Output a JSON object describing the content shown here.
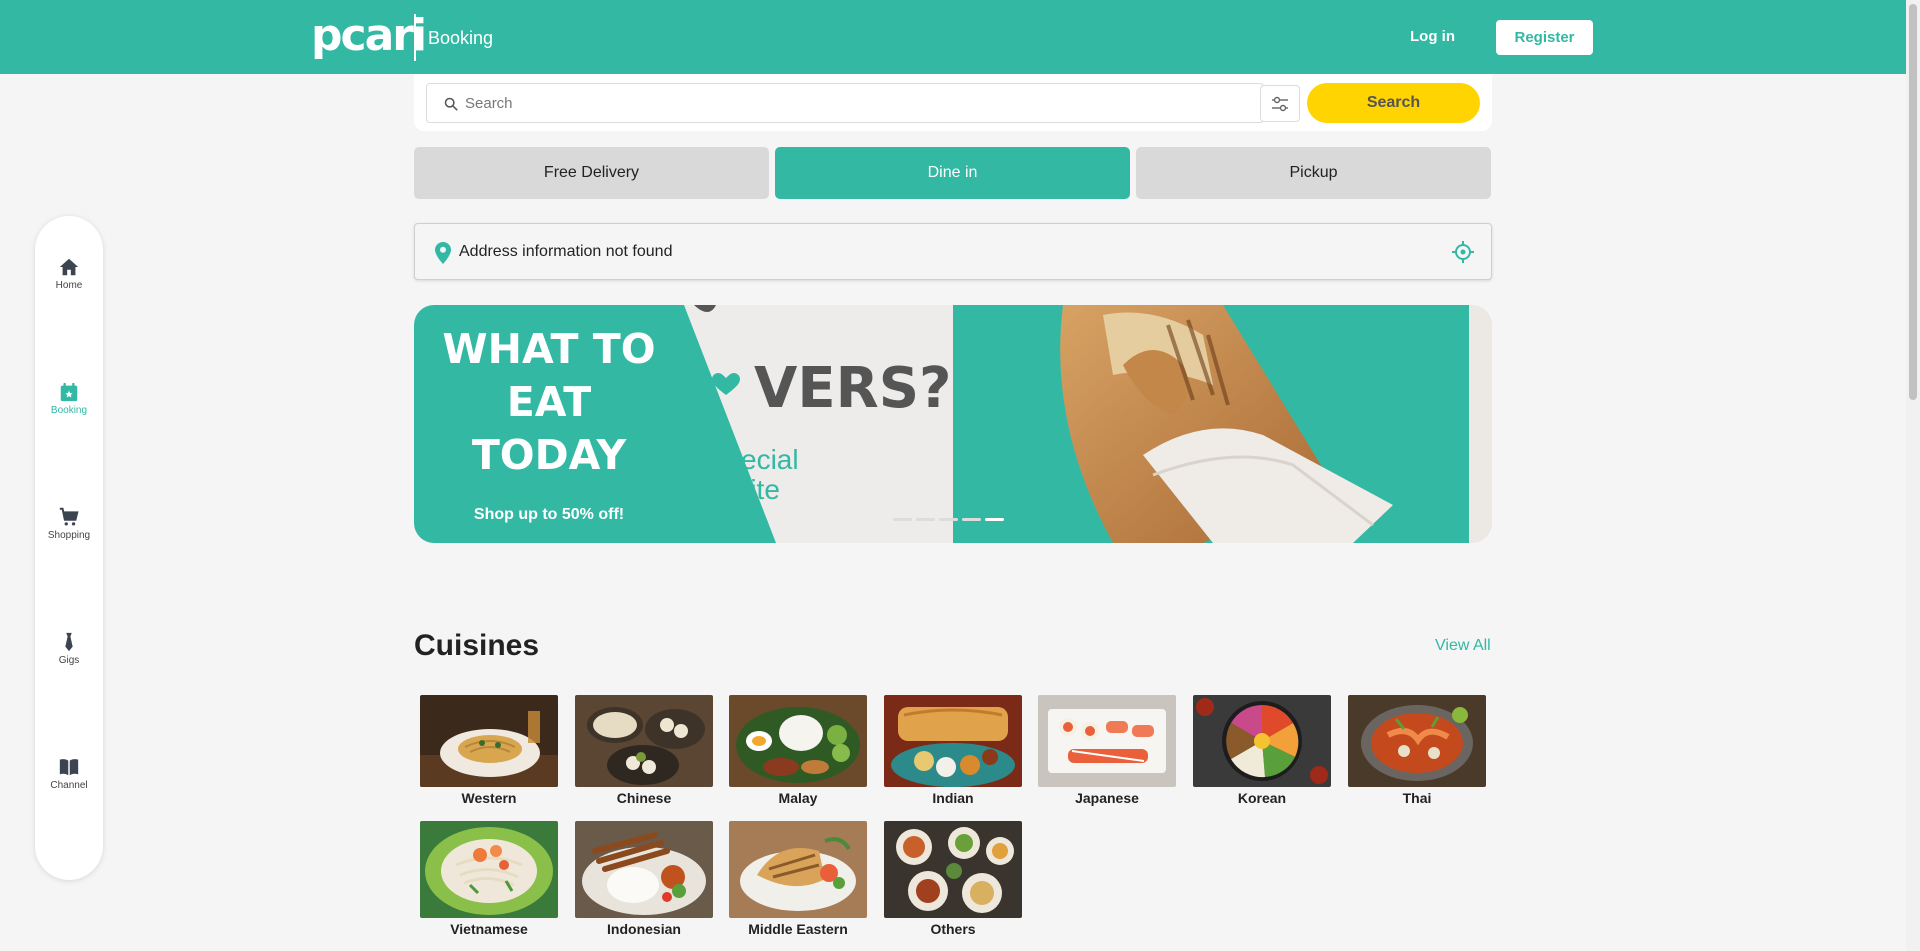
{
  "header": {
    "logo": "pcari",
    "section": "Booking",
    "login_label": "Log in",
    "register_label": "Register",
    "brand_color": "#33b8a4"
  },
  "sidebar": {
    "items": [
      {
        "label": "Home",
        "icon": "home-icon"
      },
      {
        "label": "Booking",
        "icon": "calendar-star-icon",
        "active": true
      },
      {
        "label": "Shopping",
        "icon": "cart-icon"
      },
      {
        "label": "Gigs",
        "icon": "tie-icon"
      },
      {
        "label": "Channel",
        "icon": "book-icon"
      }
    ]
  },
  "search": {
    "placeholder": "Search",
    "button_label": "Search",
    "button_color": "#ffd400"
  },
  "modes": {
    "items": [
      {
        "label": "Free Delivery"
      },
      {
        "label": "Dine in",
        "active": true
      },
      {
        "label": "Pickup"
      }
    ]
  },
  "address": {
    "text": "Address information not found"
  },
  "banner": {
    "title": "WHAT TO EAT TODAY",
    "subtitle": "Shop up to 50% off!",
    "mid_text": "VERS?",
    "mid_text2": "ecial\nrite",
    "slide_count": 5,
    "active_slide": 5
  },
  "cuisines": {
    "title": "Cuisines",
    "view_all_label": "View All",
    "items": [
      {
        "name": "Western"
      },
      {
        "name": "Chinese"
      },
      {
        "name": "Malay"
      },
      {
        "name": "Indian"
      },
      {
        "name": "Japanese"
      },
      {
        "name": "Korean"
      },
      {
        "name": "Thai"
      },
      {
        "name": "Vietnamese"
      },
      {
        "name": "Indonesian"
      },
      {
        "name": "Middle Eastern"
      },
      {
        "name": "Others"
      }
    ]
  }
}
